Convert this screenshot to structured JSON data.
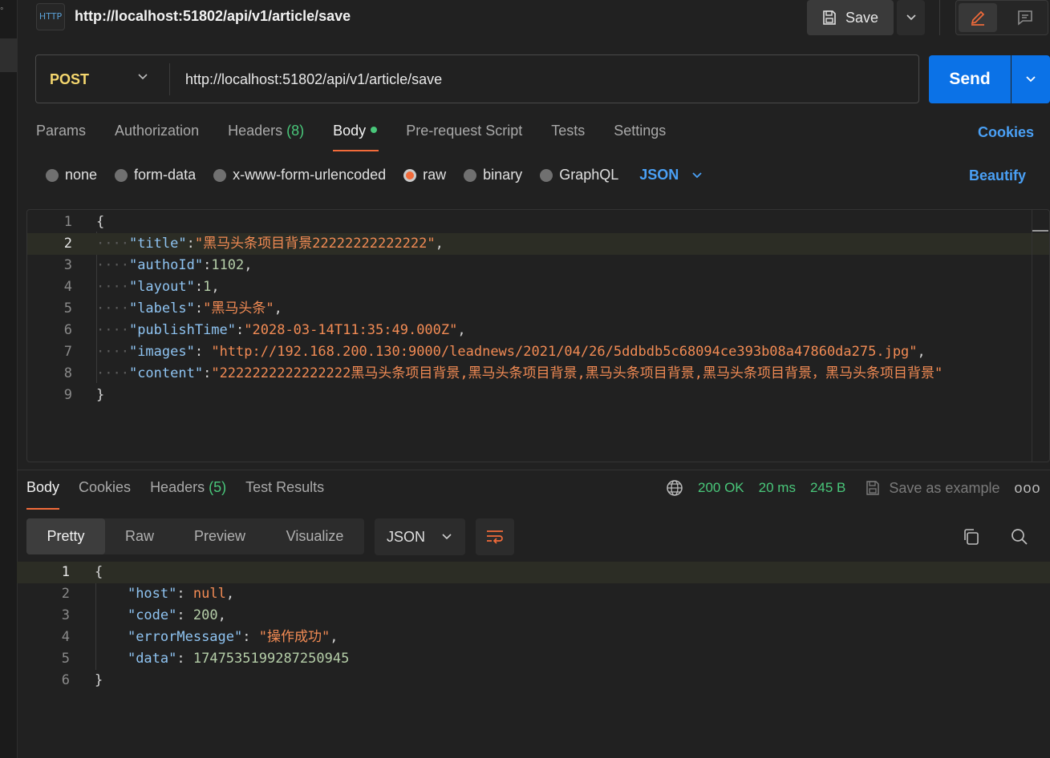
{
  "request": {
    "title": "http://localhost:51802/api/v1/article/save",
    "method": "POST",
    "url": "http://localhost:51802/api/v1/article/save",
    "http_badge": "HTTP"
  },
  "toolbar": {
    "save_label": "Save",
    "send_label": "Send"
  },
  "req_tabs": [
    {
      "label": "Params"
    },
    {
      "label": "Authorization"
    },
    {
      "label": "Headers",
      "count": "(8)"
    },
    {
      "label": "Body"
    },
    {
      "label": "Pre-request Script"
    },
    {
      "label": "Tests"
    },
    {
      "label": "Settings"
    }
  ],
  "cookies_link": "Cookies",
  "body_types": [
    "none",
    "form-data",
    "x-www-form-urlencoded",
    "raw",
    "binary",
    "GraphQL"
  ],
  "body_format": "JSON",
  "beautify": "Beautify",
  "request_body": [
    {
      "n": "1",
      "t": "{"
    },
    {
      "n": "2",
      "k": "\"title\"",
      "v": "\"黑马头条项目背景22222222222222\"",
      "e": ","
    },
    {
      "n": "3",
      "k": "\"authoId\"",
      "v": "1102",
      "e": ","
    },
    {
      "n": "4",
      "k": "\"layout\"",
      "v": "1",
      "e": ","
    },
    {
      "n": "5",
      "k": "\"labels\"",
      "v": "\"黑马头条\"",
      "e": ","
    },
    {
      "n": "6",
      "k": "\"publishTime\"",
      "v": "\"2028-03-14T11:35:49.000Z\"",
      "e": ","
    },
    {
      "n": "7",
      "k": "\"images\"",
      "v": " \"http://192.168.200.130:9000/leadnews/2021/04/26/5ddbdb5c68094ce393b08a47860da275.jpg\"",
      "e": ","
    },
    {
      "n": "8",
      "k": "\"content\"",
      "v": "\"2222222222222222黑马头条项目背景,黑马头条项目背景,黑马头条项目背景,黑马头条项目背景，黑马头条项目背景\"",
      "e": ""
    },
    {
      "n": "9",
      "t": "}"
    }
  ],
  "resp_tabs": [
    {
      "label": "Body"
    },
    {
      "label": "Cookies"
    },
    {
      "label": "Headers",
      "count": "(5)"
    },
    {
      "label": "Test Results"
    }
  ],
  "response_meta": {
    "status": "200 OK",
    "time": "20 ms",
    "size": "245 B",
    "save_example": "Save as example"
  },
  "view_modes": [
    "Pretty",
    "Raw",
    "Preview",
    "Visualize"
  ],
  "response_format": "JSON",
  "response_body": [
    {
      "n": "1",
      "t": "{"
    },
    {
      "n": "2",
      "k": "\"host\"",
      "v": "null",
      "e": ","
    },
    {
      "n": "3",
      "k": "\"code\"",
      "v": "200",
      "e": ","
    },
    {
      "n": "4",
      "k": "\"errorMessage\"",
      "v": "\"操作成功\"",
      "e": ","
    },
    {
      "n": "5",
      "k": "\"data\"",
      "v": "1747535199287250945",
      "e": ""
    },
    {
      "n": "6",
      "t": "}"
    }
  ],
  "colors": {
    "accent": "#f26b3a",
    "send": "#0b72e7",
    "link": "#4aa0f5",
    "ok": "#49c77a",
    "method": "#f5d76e"
  }
}
